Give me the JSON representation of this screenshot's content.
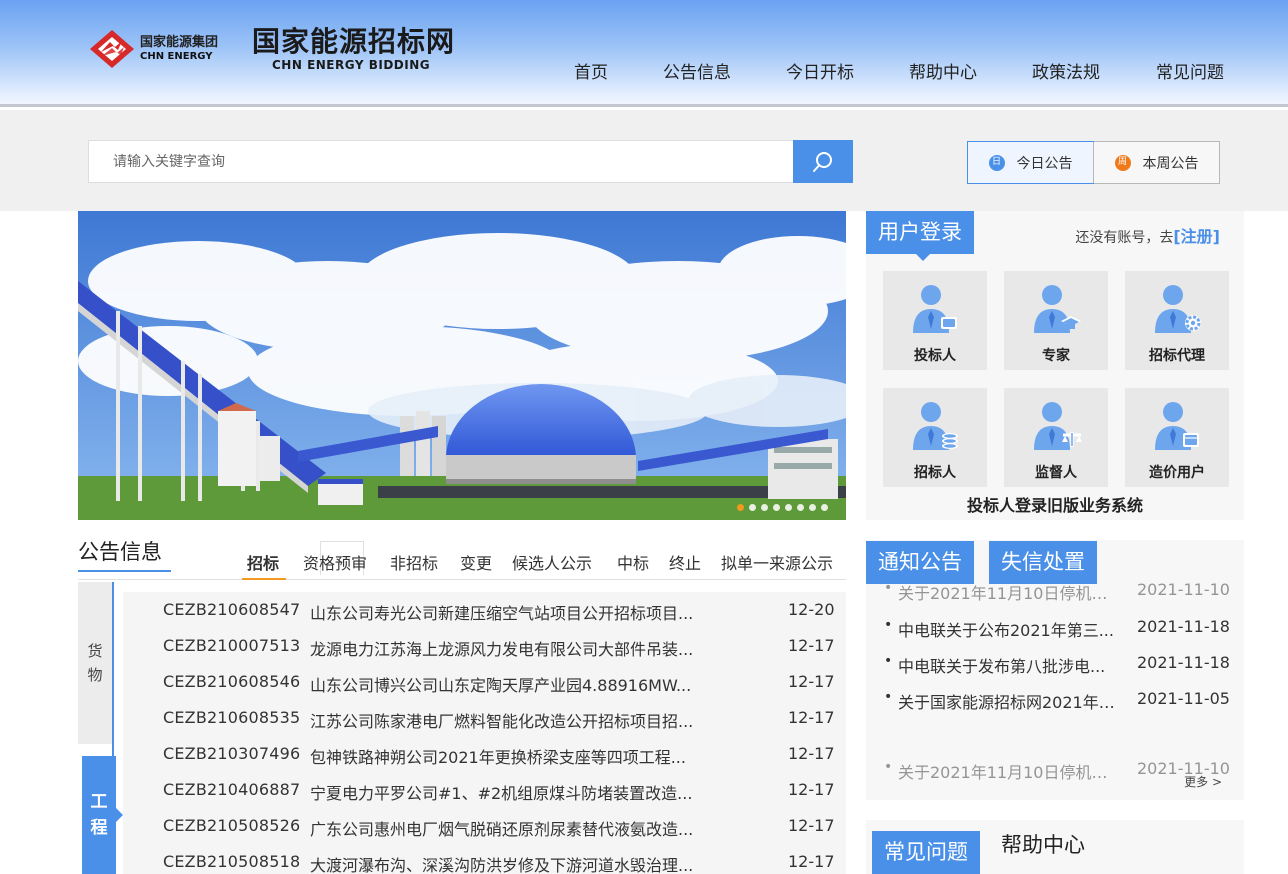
{
  "brand": {
    "group_cn": "国家能源集团",
    "group_en": "CHN ENERGY",
    "site_title_cn": "国家能源招标网",
    "site_title_en": "CHN ENERGY BIDDING",
    "accent_color": "#4a90e8",
    "logo_color": "#d7292a"
  },
  "nav": {
    "items": [
      "首页",
      "公告信息",
      "今日开标",
      "帮助中心",
      "政策法规",
      "常见问题"
    ]
  },
  "search": {
    "placeholder": "请输入关键字查询",
    "value": "",
    "button_icon": "search-icon"
  },
  "quick_tabs": [
    {
      "badge": "日",
      "label": "今日公告",
      "badge_color": "#4a90e8"
    },
    {
      "badge": "周",
      "label": "本周公告",
      "badge_color": "#f07a1a"
    }
  ],
  "banner": {
    "slide_count": 8,
    "active_slide": 0
  },
  "announcements": {
    "title": "公告信息",
    "tabs": [
      "招标",
      "资格预审",
      "非招标",
      "变更",
      "候选人公示",
      "中标",
      "终止",
      "拟单一来源公示"
    ],
    "active_tab": "招标",
    "categories": {
      "goods": [
        "货",
        "物"
      ],
      "engineering": [
        "工",
        "程"
      ]
    },
    "rows": [
      {
        "code": "CEZB210608547",
        "title": "山东公司寿光公司新建压缩空气站项目公开招标项目...",
        "date": "12-20"
      },
      {
        "code": "CEZB210007513",
        "title": "龙源电力江苏海上龙源风力发电有限公司大部件吊装...",
        "date": "12-17"
      },
      {
        "code": "CEZB210608546",
        "title": "山东公司博兴公司山东定陶天厚产业园4.88916MW...",
        "date": "12-17"
      },
      {
        "code": "CEZB210608535",
        "title": "江苏公司陈家港电厂燃料智能化改造公开招标项目招...",
        "date": "12-17"
      },
      {
        "code": "CEZB210307496",
        "title": "包神铁路神朔公司2021年更换桥梁支座等四项工程...",
        "date": "12-17"
      },
      {
        "code": "CEZB210406887",
        "title": "宁夏电力平罗公司#1、#2机组原煤斗防堵装置改造...",
        "date": "12-17"
      },
      {
        "code": "CEZB210508526",
        "title": "广东公司惠州电厂烟气脱硝还原剂尿素替代液氨改造...",
        "date": "12-17"
      },
      {
        "code": "CEZB210508518",
        "title": "大渡河瀑布沟、深溪沟防洪岁修及下游河道水毁治理...",
        "date": "12-17"
      }
    ]
  },
  "login": {
    "title": "用户登录",
    "register_hint": "还没有账号，去",
    "register_link": "[注册]",
    "roles": [
      {
        "label": "投标人",
        "icon": "bidder-icon"
      },
      {
        "label": "专家",
        "icon": "expert-icon"
      },
      {
        "label": "招标代理",
        "icon": "agent-icon"
      },
      {
        "label": "招标人",
        "icon": "tenderer-icon"
      },
      {
        "label": "监督人",
        "icon": "supervisor-icon"
      },
      {
        "label": "造价用户",
        "icon": "cost-user-icon"
      }
    ],
    "old_system_link": "投标人登录旧版业务系统"
  },
  "notices": {
    "tabs": [
      "通知公告",
      "失信处置"
    ],
    "rows": [
      {
        "title": "中电联关于公布2021年第三...",
        "date": "2021-11-18"
      },
      {
        "title": "中电联关于发布第八批涉电...",
        "date": "2021-11-18"
      },
      {
        "title": "关于国家能源招标网2021年1...",
        "date": "2021-11-05"
      },
      {
        "title": "关于2021年11月10日停机维...",
        "date": "2021-11-10"
      }
    ],
    "more": "更多 >"
  },
  "faq": {
    "title": "常见问题",
    "help": "帮助中心"
  }
}
